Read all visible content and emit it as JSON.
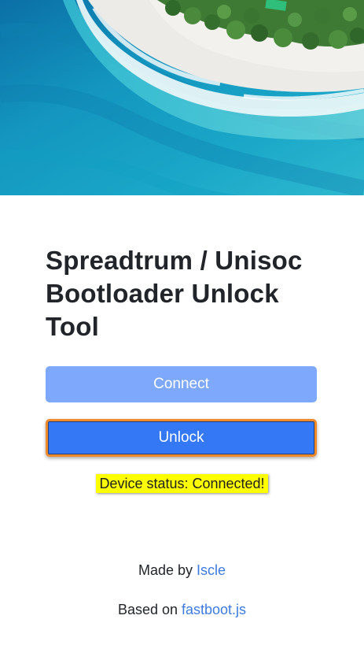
{
  "hero": {
    "image_desc_icon": "beach-aerial-image"
  },
  "page": {
    "title": "Spreadtrum / Unisoc Bootloader Unlock Tool"
  },
  "buttons": {
    "connect_label": "Connect",
    "unlock_label": "Unlock"
  },
  "status": {
    "text": "Device status: Connected!"
  },
  "footer": {
    "made_by_prefix": "Made by ",
    "made_by_link": "Iscle",
    "based_on_prefix": "Based on ",
    "based_on_link": "fastboot.js"
  },
  "colors": {
    "connect_button": "#7ea8fb",
    "unlock_button": "#3478f6",
    "unlock_focus_border": "#ee8a2a",
    "status_highlight": "#ffff00",
    "link": "#3d7be0"
  }
}
